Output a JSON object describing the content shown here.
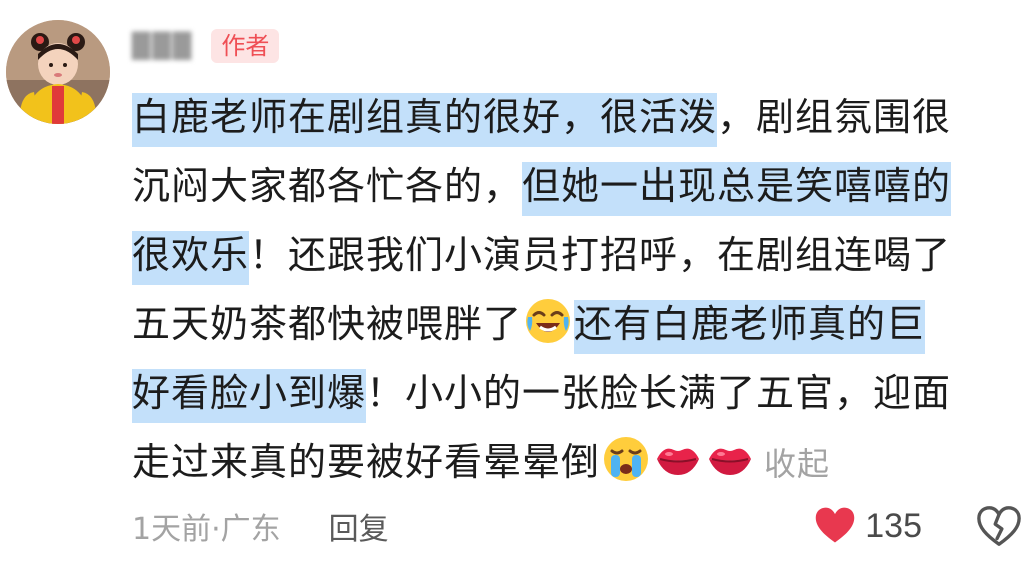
{
  "user": {
    "name": "███",
    "badge": "作者"
  },
  "comment": {
    "segments": [
      "白鹿老师在剧组真的很好，很活泼",
      "，剧组氛围很",
      "沉闷大家都各忙各的，",
      "但她一出现总是笑嘻嘻的",
      "很欢乐",
      "！还跟我们小演员打招呼，在剧组连喝了",
      "五天奶茶都快被喂胖了",
      "还有白鹿老师真的巨",
      "好看脸小到爆",
      "！小小的一张脸长满了五官，迎面",
      "走过来真的要被好看晕晕倒"
    ],
    "emojis": [
      "laughing-crying-emoji",
      "crying-emoji",
      "kiss-lips-emoji",
      "kiss-lips-emoji"
    ],
    "collapse_label": "收起"
  },
  "footer": {
    "meta": "1天前·广东",
    "reply_label": "回复",
    "like_count": "135"
  },
  "colors": {
    "highlight": "#c3e0fa",
    "badge_bg": "#fde4e4",
    "badge_text": "#ef4f55",
    "like": "#e8384f"
  }
}
